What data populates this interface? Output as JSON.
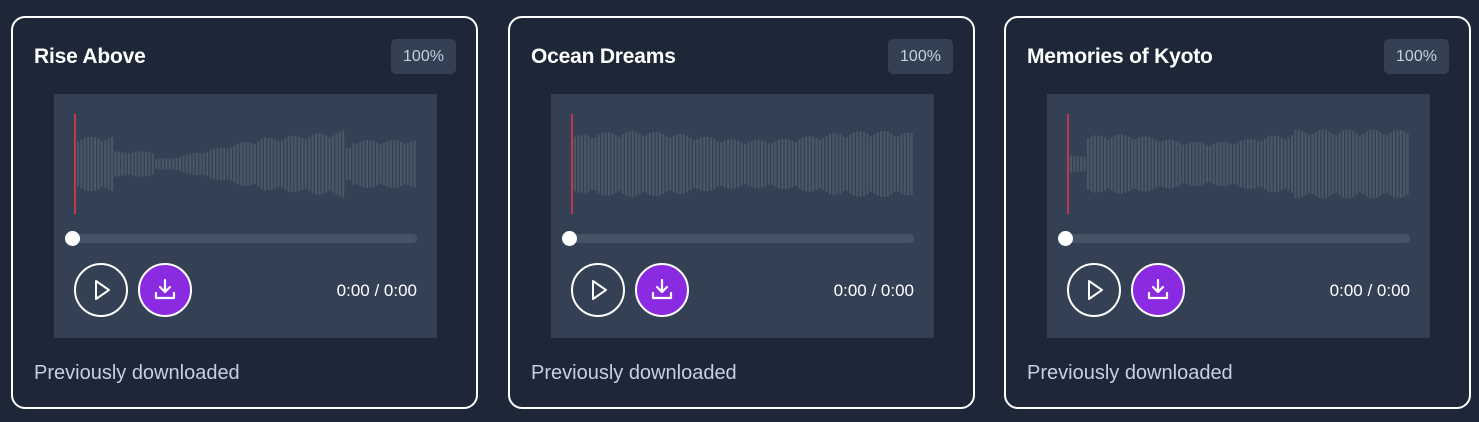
{
  "colors": {
    "background": "#1e2738",
    "card_border": "#ffffff",
    "player_bg": "#344154",
    "waveform_bar": "#4b5869",
    "playhead": "#c0394b",
    "download_button": "#8a2be2"
  },
  "icons": {
    "play": "play-icon",
    "download": "download-icon"
  },
  "cards": [
    {
      "title": "Rise Above",
      "percent": "100%",
      "time": "0:00 / 0:00",
      "status": "Previously downloaded",
      "progress": 0
    },
    {
      "title": "Ocean Dreams",
      "percent": "100%",
      "time": "0:00 / 0:00",
      "status": "Previously downloaded",
      "progress": 0
    },
    {
      "title": "Memories of Kyoto",
      "percent": "100%",
      "time": "0:00 / 0:00",
      "status": "Previously downloaded",
      "progress": 0
    }
  ]
}
